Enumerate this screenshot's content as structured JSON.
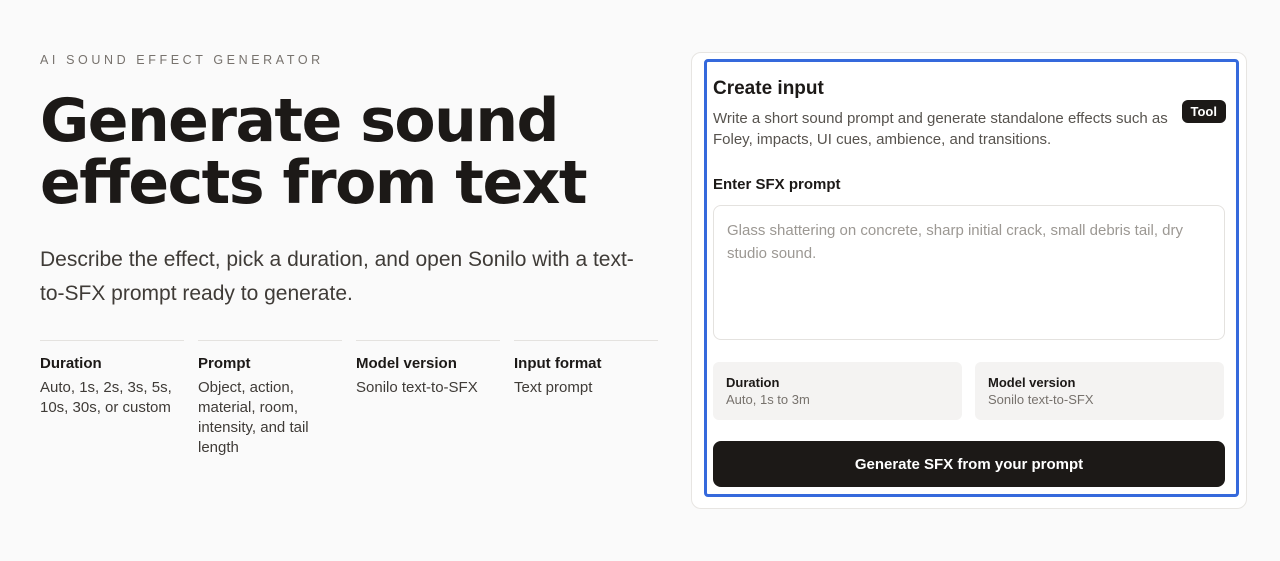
{
  "hero": {
    "eyebrow": "AI SOUND EFFECT GENERATOR",
    "title": "Generate sound effects from text",
    "subtitle": "Describe the effect, pick a duration, and open Sonilo with a text-to-SFX prompt ready to generate."
  },
  "specs": [
    {
      "title": "Duration",
      "value": "Auto, 1s, 2s, 3s, 5s, 10s, 30s, or custom"
    },
    {
      "title": "Prompt",
      "value": "Object, action, material, room, intensity, and tail length"
    },
    {
      "title": "Model version",
      "value": "Sonilo text-to-SFX"
    },
    {
      "title": "Input format",
      "value": "Text prompt"
    }
  ],
  "card": {
    "title": "Create input",
    "description": "Write a short sound prompt and generate standalone effects such as Foley, impacts, UI cues, ambience, and transitions.",
    "badge": "Tool",
    "prompt_label": "Enter SFX prompt",
    "prompt_value": "",
    "prompt_placeholder": "Glass shattering on concrete, sharp initial crack, small debris tail, dry studio sound.",
    "duration_title": "Duration",
    "duration_value": "Auto, 1s to 3m",
    "model_title": "Model version",
    "model_value": "Sonilo text-to-SFX",
    "generate_label": "Generate SFX from your prompt"
  },
  "colors": {
    "accent_focus": "#3569dc",
    "primary_dark": "#1c1917",
    "background": "#fafafa"
  }
}
